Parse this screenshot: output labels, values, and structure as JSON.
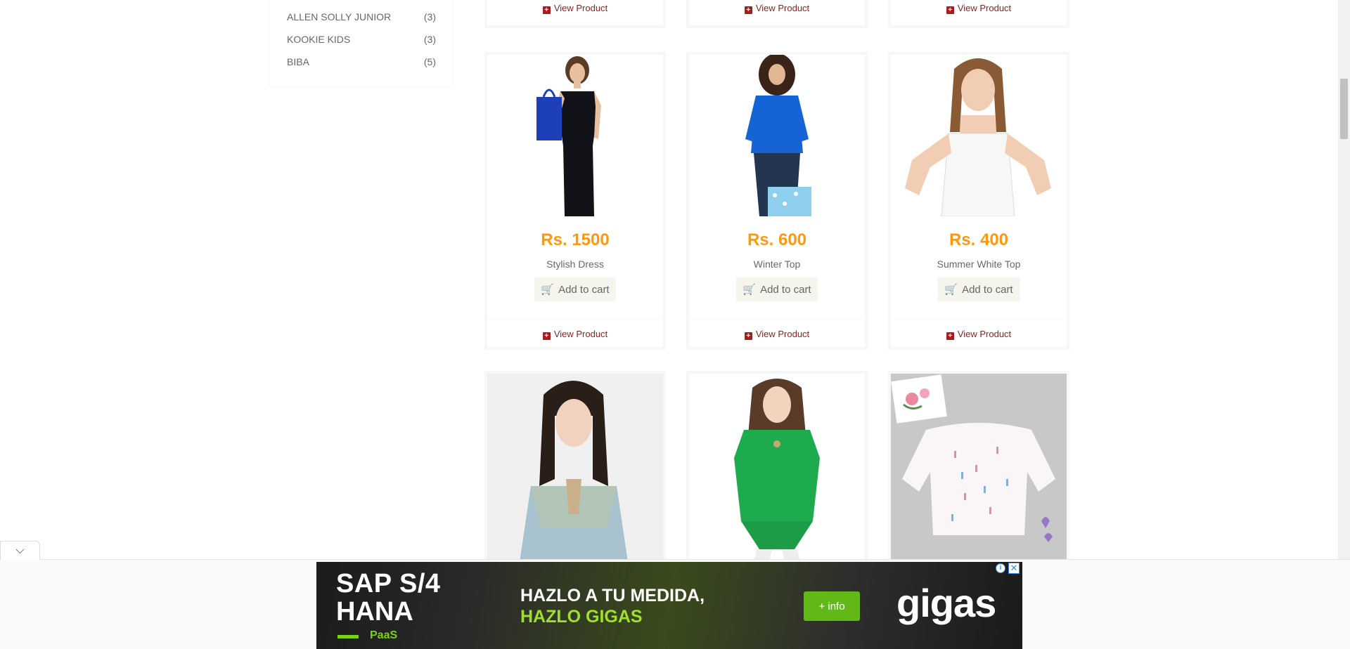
{
  "sidebar": {
    "brands": [
      {
        "name": "ALLEN SOLLY JUNIOR",
        "count": "(3)"
      },
      {
        "name": "KOOKIE KIDS",
        "count": "(3)"
      },
      {
        "name": "BIBA",
        "count": "(5)"
      }
    ]
  },
  "common": {
    "view_product": "View Product",
    "add_to_cart": "Add to cart"
  },
  "products": [
    {
      "price": "Rs. 1500",
      "name": "Stylish Dress"
    },
    {
      "price": "Rs. 600",
      "name": "Winter Top"
    },
    {
      "price": "Rs. 400",
      "name": "Summer White Top"
    }
  ],
  "ad": {
    "title_line1": "SAP S/4",
    "title_line2": "HANA",
    "sub": "PaaS",
    "slogan_line1": "HAZLO A TU MEDIDA,",
    "slogan_line2": "HAZLO GIGAS",
    "button": "+ info",
    "logo": "gigas",
    "info_glyph": "i",
    "close_glyph": "✕"
  },
  "collapse_glyph": "⌵",
  "colors": {
    "price": "#FE980F",
    "link_red": "#8b1f1f",
    "button_bg": "#F5F5ED",
    "ad_green": "#62b816"
  }
}
